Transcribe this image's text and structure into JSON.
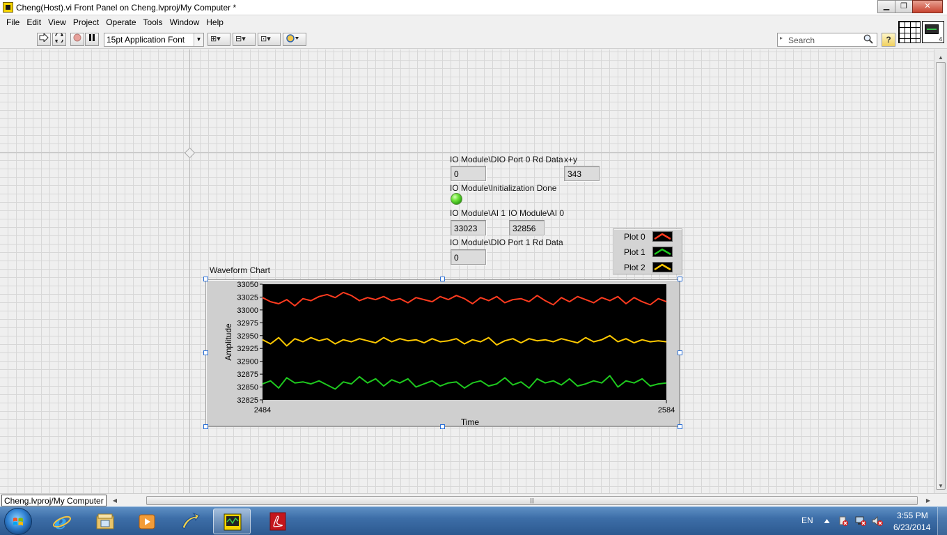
{
  "window": {
    "title": "Cheng(Host).vi Front Panel on Cheng.lvproj/My Computer *"
  },
  "menu": [
    "File",
    "Edit",
    "View",
    "Project",
    "Operate",
    "Tools",
    "Window",
    "Help"
  ],
  "toolbar": {
    "font_select": "15pt Application Font",
    "search_placeholder": "Search",
    "help_label": "?",
    "vi_icon_number": "4"
  },
  "panel": {
    "dio0_label": "IO Module\\DIO Port 0 Rd Data",
    "dio0_value": "0",
    "xy_label": "x+y",
    "xy_value": "343",
    "init_label": "IO Module\\Initialization Done",
    "ai1_label": "IO Module\\AI 1",
    "ai1_value": "33023",
    "ai0_label": "IO Module\\AI 0",
    "ai0_value": "32856",
    "dio1_label": "IO Module\\DIO Port 1 Rd Data",
    "dio1_value": "0",
    "chart_label": "Waveform Chart"
  },
  "legend": [
    {
      "name": "Plot 0",
      "color": "#ff3b1f"
    },
    {
      "name": "Plot 1",
      "color": "#1ec81e"
    },
    {
      "name": "Plot 2",
      "color": "#ffc800"
    }
  ],
  "chart_data": {
    "type": "line",
    "title": "Waveform Chart",
    "xlabel": "Time",
    "ylabel": "Amplitude",
    "xlim": [
      2484,
      2584
    ],
    "ylim": [
      32825,
      33050
    ],
    "x_ticks": [
      "2484",
      "2584"
    ],
    "y_ticks": [
      "33050",
      "33025",
      "33000",
      "32975",
      "32950",
      "32925",
      "32900",
      "32875",
      "32850",
      "32825"
    ],
    "x": [
      2484,
      2486,
      2488,
      2490,
      2492,
      2494,
      2496,
      2498,
      2500,
      2502,
      2504,
      2506,
      2508,
      2510,
      2512,
      2514,
      2516,
      2518,
      2520,
      2522,
      2524,
      2526,
      2528,
      2530,
      2532,
      2534,
      2536,
      2538,
      2540,
      2542,
      2544,
      2546,
      2548,
      2550,
      2552,
      2554,
      2556,
      2558,
      2560,
      2562,
      2564,
      2566,
      2568,
      2570,
      2572,
      2574,
      2576,
      2578,
      2580,
      2582,
      2584
    ],
    "series": [
      {
        "name": "Plot 0",
        "color": "#ff3b1f",
        "values": [
          33024,
          33016,
          33012,
          33020,
          33008,
          33022,
          33018,
          33026,
          33030,
          33024,
          33034,
          33028,
          33018,
          33024,
          33020,
          33026,
          33018,
          33022,
          33014,
          33024,
          33020,
          33016,
          33026,
          33020,
          33028,
          33022,
          33012,
          33024,
          33018,
          33026,
          33014,
          33020,
          33022,
          33016,
          33028,
          33018,
          33010,
          33024,
          33016,
          33026,
          33020,
          33014,
          33024,
          33018,
          33026,
          33012,
          33024,
          33016,
          33010,
          33022,
          33016
        ]
      },
      {
        "name": "Plot 1",
        "color": "#1ec81e",
        "values": [
          32856,
          32862,
          32848,
          32868,
          32858,
          32860,
          32856,
          32862,
          32854,
          32846,
          32860,
          32856,
          32870,
          32858,
          32866,
          32852,
          32864,
          32858,
          32866,
          32850,
          32856,
          32862,
          32852,
          32858,
          32860,
          32848,
          32858,
          32862,
          32852,
          32856,
          32868,
          32854,
          32860,
          32848,
          32866,
          32858,
          32862,
          32854,
          32866,
          32852,
          32856,
          32862,
          32858,
          32872,
          32850,
          32862,
          32858,
          32866,
          32852,
          32856,
          32858
        ]
      },
      {
        "name": "Plot 2",
        "color": "#ffc800",
        "values": [
          32942,
          32934,
          32946,
          32930,
          32944,
          32938,
          32946,
          32940,
          32944,
          32934,
          32942,
          32938,
          32944,
          32940,
          32936,
          32946,
          32938,
          32944,
          32940,
          32942,
          32936,
          32944,
          32938,
          32940,
          32944,
          32934,
          32942,
          32938,
          32946,
          32932,
          32940,
          32944,
          32936,
          32944,
          32940,
          32942,
          32938,
          32944,
          32940,
          32936,
          32946,
          32938,
          32942,
          32950,
          32938,
          32944,
          32936,
          32942,
          32938,
          32940,
          32938
        ]
      }
    ],
    "grid": false,
    "legend_position": "top-right"
  },
  "status": {
    "project_path": "Cheng.lvproj/My Computer"
  },
  "taskbar": {
    "language": "EN",
    "time": "3:55 PM",
    "date": "6/23/2014"
  }
}
